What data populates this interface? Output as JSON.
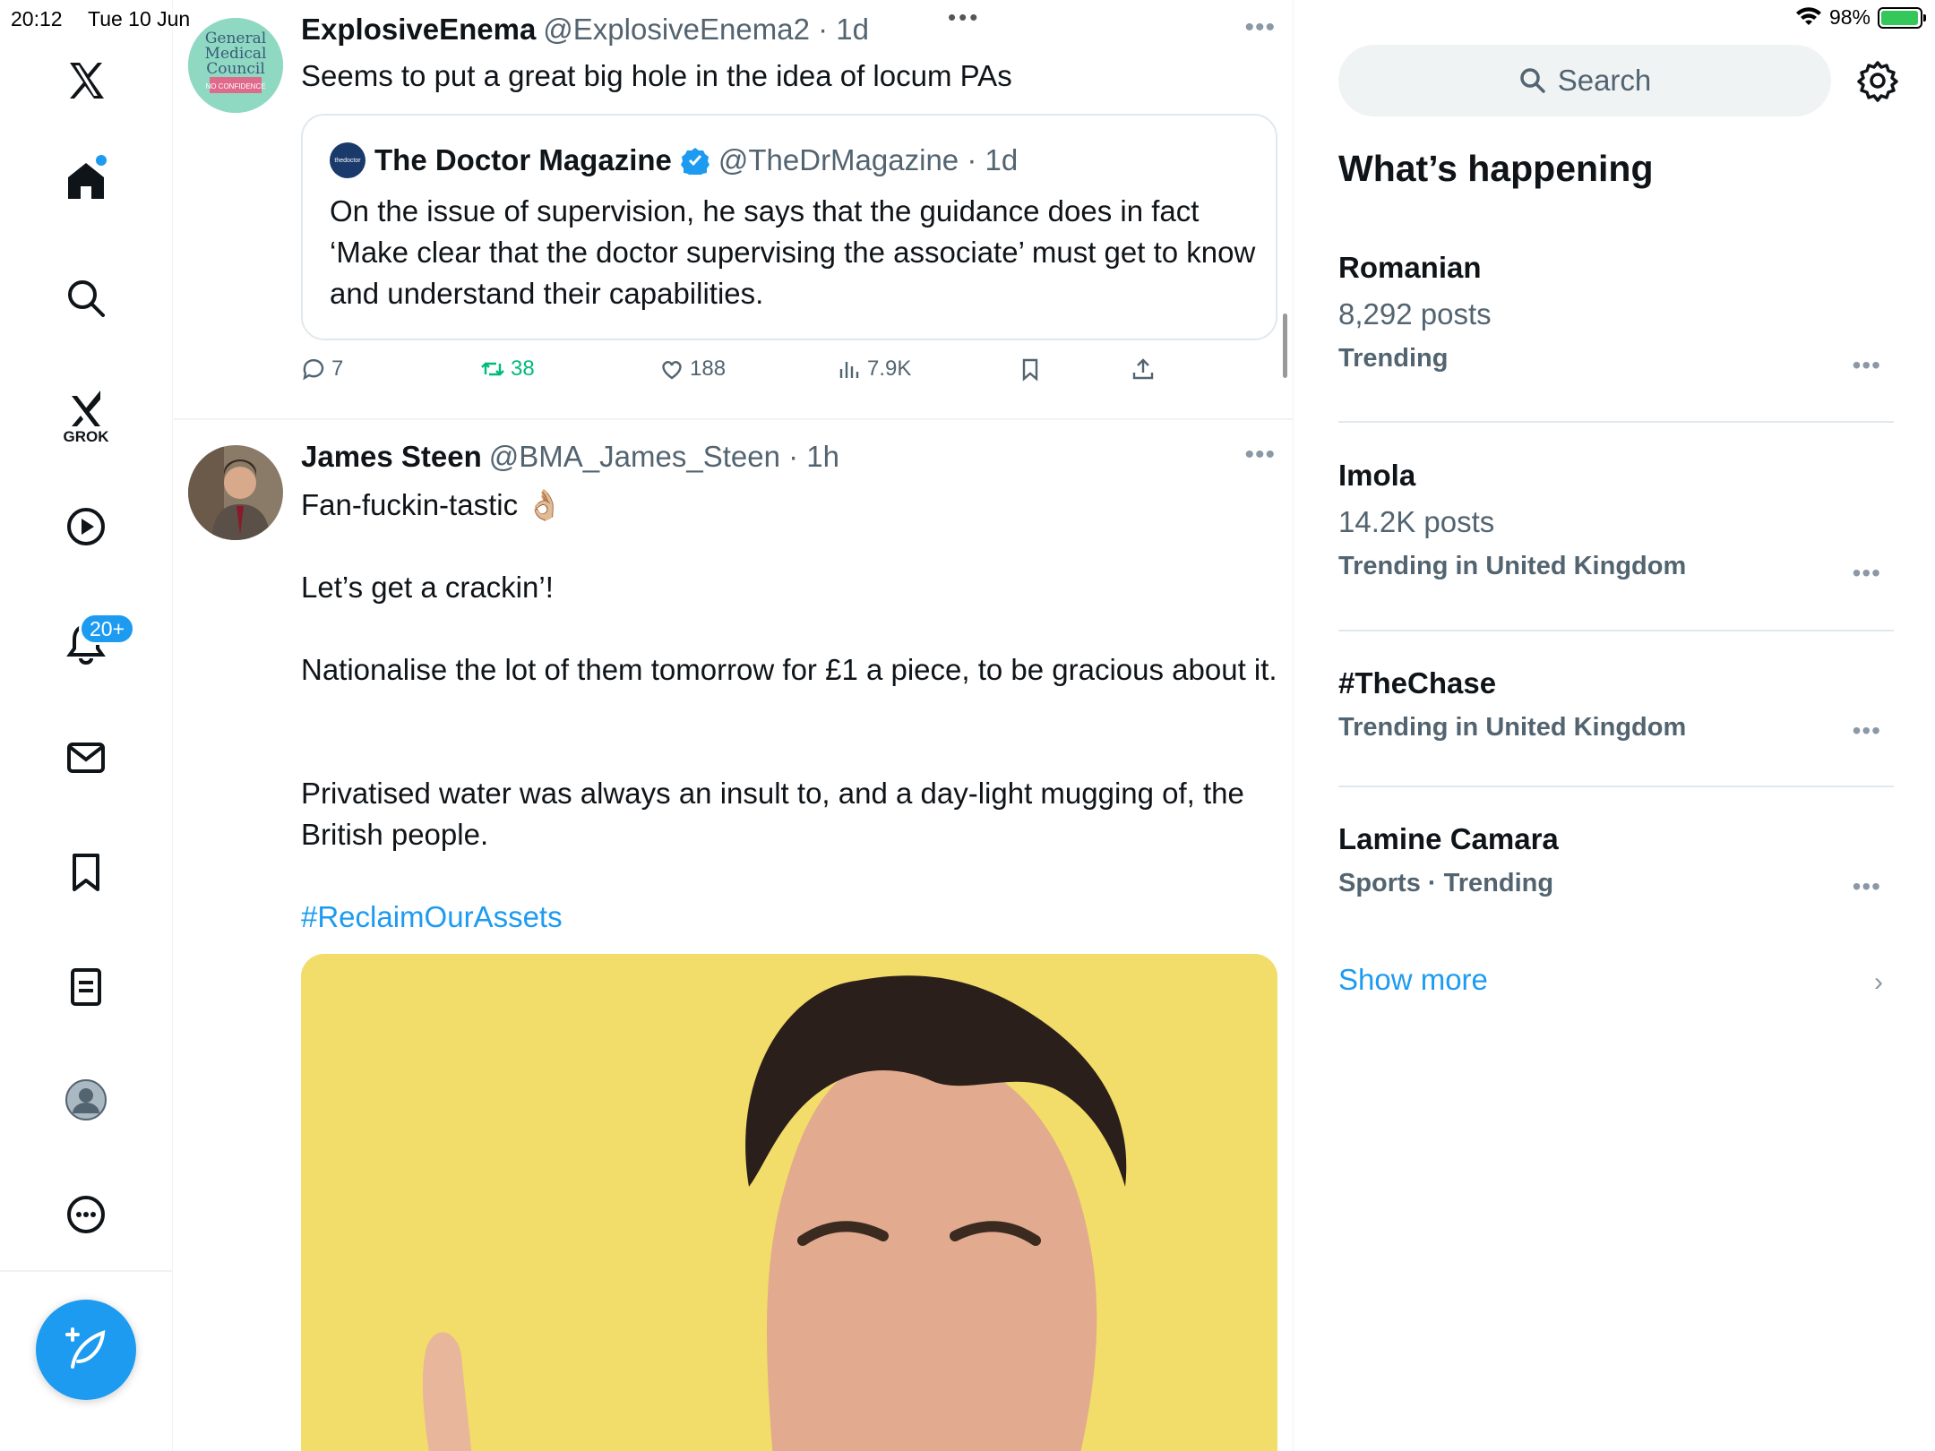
{
  "status_bar": {
    "time": "20:12",
    "date": "Tue 10 Jun",
    "battery": "98%",
    "battery_level": 0.98
  },
  "nav": {
    "grok_label": "GROK",
    "notifications_badge": "20+"
  },
  "tweets": [
    {
      "name": "ExplosiveEnema",
      "handle": "@ExplosiveEnema2 · 1d",
      "text": "Seems to put a great big hole in the idea of locum PAs",
      "avatar_text": [
        "General",
        "Medical",
        "Council",
        "NO CONFIDENCE"
      ],
      "quote": {
        "avatar_text": "thedoctor",
        "name": "The Doctor Magazine",
        "handle": "@TheDrMagazine · 1d",
        "text": "On the issue of supervision, he says that the guidance does in fact ‘Make clear that the doctor supervising the associate’ must get to know and understand their capabilities."
      },
      "actions": {
        "replies": "7",
        "reposts": "38",
        "likes": "188",
        "views": "7.9K"
      }
    },
    {
      "name": "James Steen",
      "handle": "@BMA_James_Steen · 1h",
      "lines": [
        "Fan-fuckin-tastic 👌🏼",
        "Let’s get a crackin’!",
        "Nationalise the lot of them tomorrow for £1 a piece, to be gracious about it.",
        "Privatised water was always an insult to, and a day-light mugging of, the British people."
      ],
      "hashtag": "#ReclaimOurAssets"
    }
  ],
  "sidebar": {
    "search_placeholder": "Search",
    "title": "What’s happening",
    "trends": [
      {
        "title": "Romanian",
        "meta": "8,292 posts",
        "context": "Trending"
      },
      {
        "title": "Imola",
        "meta": "14.2K posts",
        "context": "Trending in United Kingdom"
      },
      {
        "title": "#TheChase",
        "context": "Trending in United Kingdom"
      },
      {
        "title": "Lamine Camara",
        "context": "Sports · Trending"
      }
    ],
    "show_more": "Show more"
  },
  "colors": {
    "accent": "#1d9bf0",
    "repost_active": "#00ba7c",
    "muted": "#536471"
  }
}
